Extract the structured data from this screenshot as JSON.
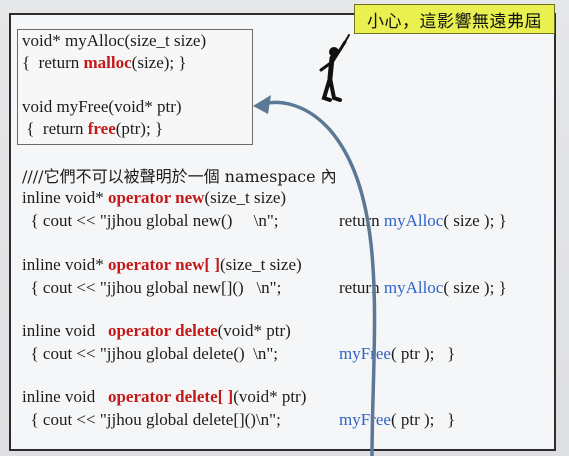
{
  "callout": {
    "text": "小心，這影響無遠弗屆"
  },
  "alloc_box": {
    "line1": "void* myAlloc(size_t size)",
    "line2_a": "{  return ",
    "line2_b": "malloc",
    "line2_c": "(size); }",
    "line3": "void myFree(void* ptr)",
    "line4_a": " {  return ",
    "line4_b": "free",
    "line4_c": "(ptr); }"
  },
  "comment": "////它們不可以被聲明於一個 namespace 內",
  "blocks": [
    {
      "sig_a": "inline void* ",
      "sig_b": "operator new",
      "sig_c": "(size_t size)",
      "body_a": "  { cout << \"jjhou global new()     \\n\";",
      "ret_a": "return ",
      "ret_b": "myAlloc",
      "ret_c": "( size ); }"
    },
    {
      "sig_a": "inline void* ",
      "sig_b": "operator new[ ]",
      "sig_c": "(size_t size)",
      "body_a": "  { cout << \"jjhou global new[]()   \\n\";",
      "ret_a": "return ",
      "ret_b": "myAlloc",
      "ret_c": "( size ); }"
    },
    {
      "sig_a": "inline void   ",
      "sig_b": "operator delete",
      "sig_c": "(void* ptr)",
      "body_a": "  { cout << \"jjhou global delete()  \\n\";",
      "ret_a": "",
      "ret_b": "myFree",
      "ret_c": "( ptr );   }"
    },
    {
      "sig_a": "inline void   ",
      "sig_b": "operator delete[ ]",
      "sig_c": "(void* ptr)",
      "body_a": "  { cout << \"jjhou global delete[]()\\n\";",
      "ret_a": "",
      "ret_b": "myFree",
      "ret_c": "( ptr );   }"
    }
  ],
  "colors": {
    "keyword": "#c41919",
    "function": "#2f63c7",
    "callout_bg": "#e9f04f",
    "arrow": "#5b7896"
  }
}
